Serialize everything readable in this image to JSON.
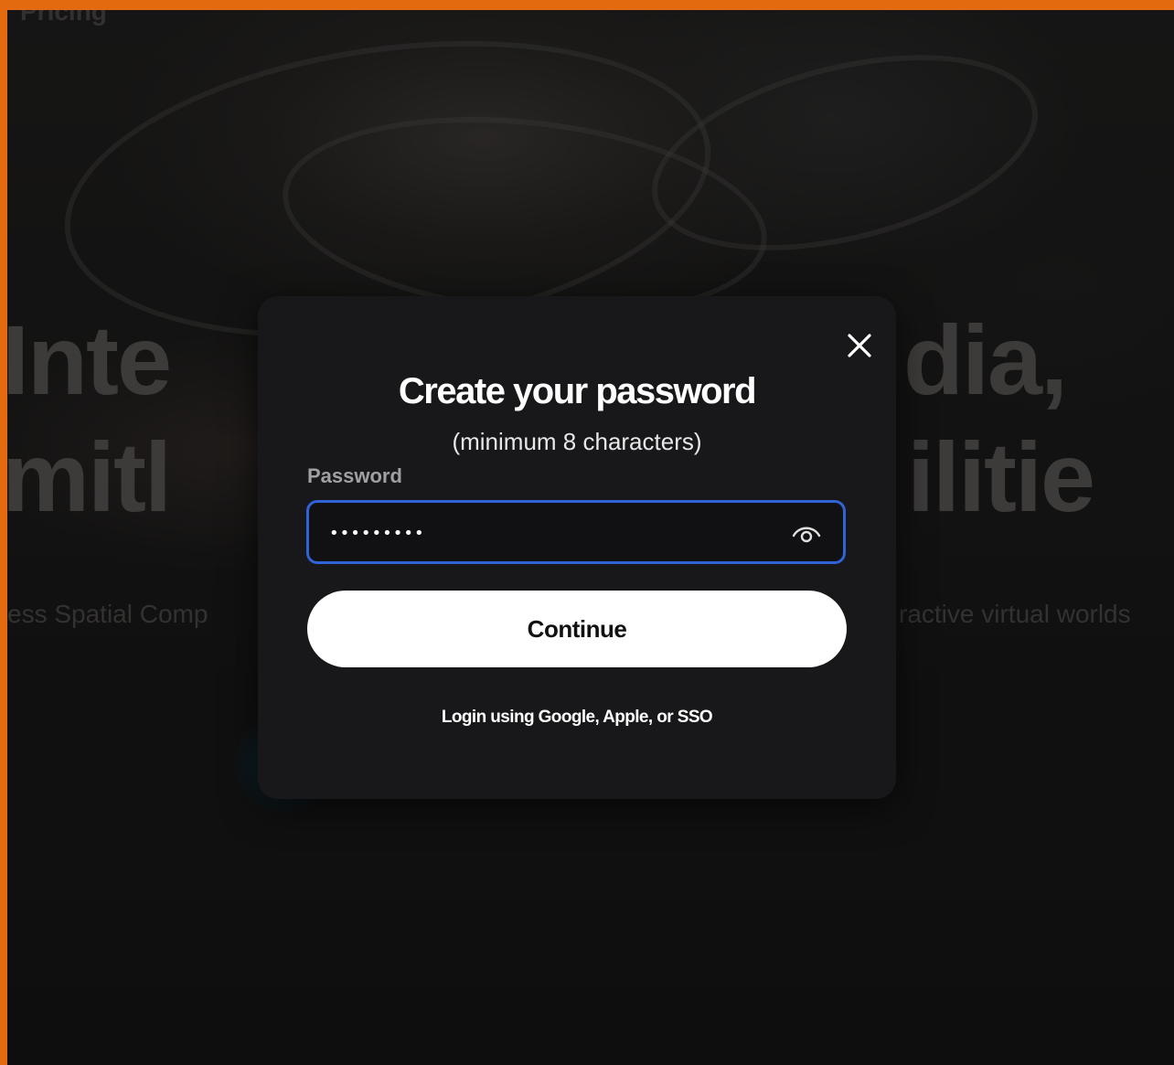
{
  "background": {
    "nav_text": "Pricing",
    "hero_line1_left": "Inte",
    "hero_line1_right": "dia,",
    "hero_line2_left": "mitl",
    "hero_line2_right": "ilitie",
    "sub_left": "ess Spatial Comp",
    "sub_right": "ractive virtual worlds"
  },
  "modal": {
    "title": "Create your password",
    "subtitle": "(minimum 8 characters)",
    "password_label": "Password",
    "password_value": "•••••••••",
    "continue_label": "Continue",
    "alt_login_label": "Login using Google, Apple, or SSO"
  },
  "icons": {
    "close": "close-icon",
    "visibility": "eye-icon"
  },
  "colors": {
    "frame_border": "#e36a0f",
    "focus_ring": "#2f63d6",
    "modal_bg": "#18181a",
    "button_bg": "#ffffff"
  }
}
